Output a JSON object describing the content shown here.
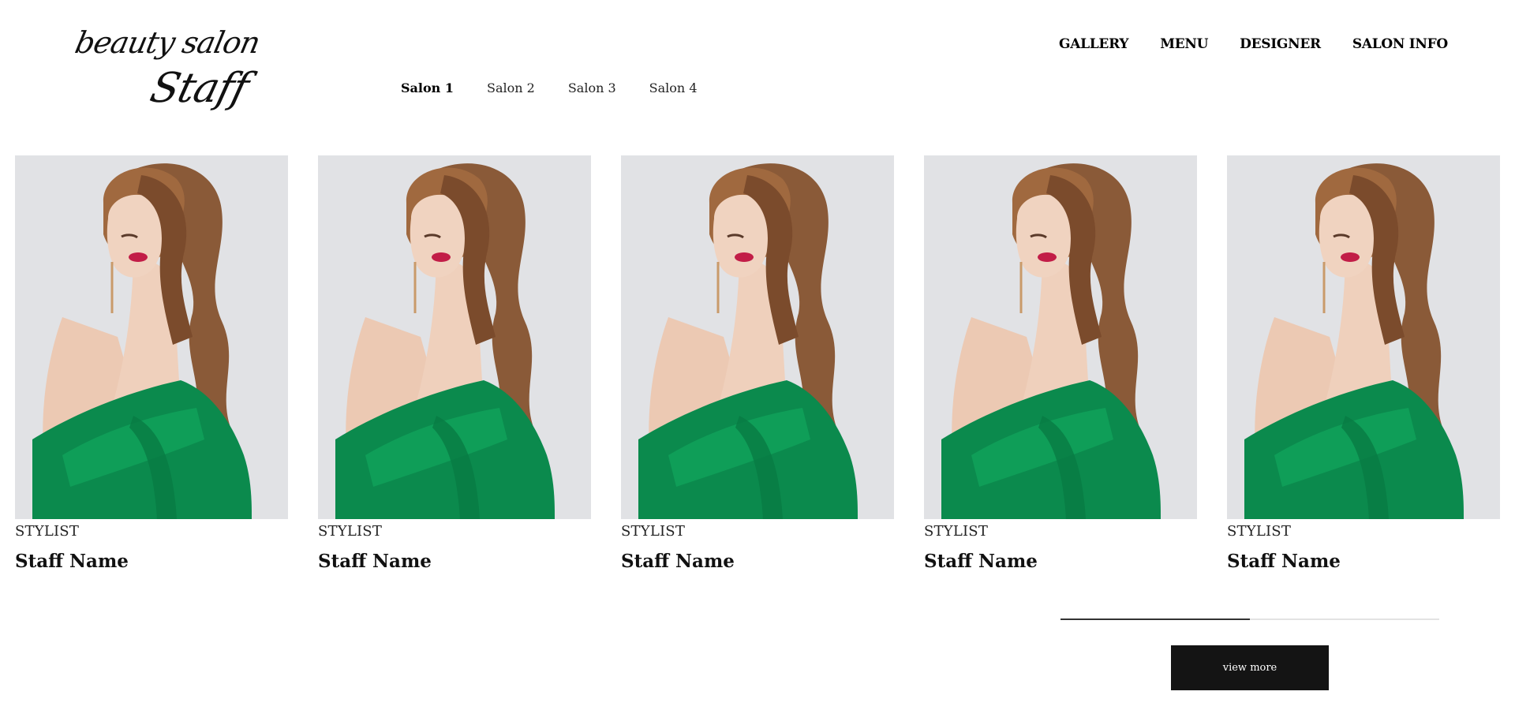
{
  "logo": {
    "line1": "beauty salon",
    "line2": "Staff"
  },
  "nav": {
    "items": [
      "GALLERY",
      "MENU",
      "DESIGNER",
      "SALON INFO"
    ]
  },
  "salon_tabs": {
    "items": [
      "Salon 1",
      "Salon 2",
      "Salon 3",
      "Salon 4"
    ],
    "active_index": 0
  },
  "staff": [
    {
      "role": "STYLIST",
      "name": "Staff Name",
      "photo": "portrait-woman-green-dress"
    },
    {
      "role": "STYLIST",
      "name": "Staff Name",
      "photo": "portrait-woman-green-dress"
    },
    {
      "role": "STYLIST",
      "name": "Staff Name",
      "photo": "portrait-woman-green-dress"
    },
    {
      "role": "STYLIST",
      "name": "Staff Name",
      "photo": "portrait-woman-green-dress"
    },
    {
      "role": "STYLIST",
      "name": "Staff Name",
      "photo": "portrait-woman-green-dress"
    }
  ],
  "scroll_progress": 0.5,
  "view_more": {
    "label": "view more"
  },
  "colors": {
    "button_bg": "#141414",
    "dress_green": "#0b8a4d",
    "hair_brown": "#8a5a38",
    "lip_red": "#c21d47",
    "photo_bg": "#e1e2e5"
  }
}
